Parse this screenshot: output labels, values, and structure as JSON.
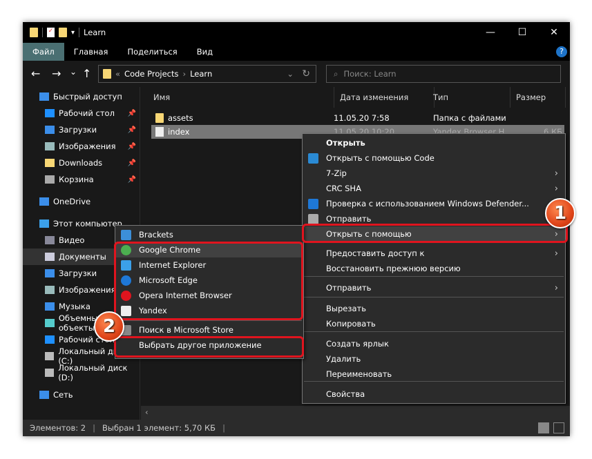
{
  "window": {
    "title": "Learn",
    "minimize": "—",
    "maximize": "☐",
    "close": "✕"
  },
  "ribbon": {
    "tabs": [
      "Файл",
      "Главная",
      "Поделиться",
      "Вид"
    ],
    "help": "?"
  },
  "nav": {
    "back": "←",
    "forward": "→",
    "recent": "⌄",
    "up": "↑",
    "breadcrumb": [
      "Code Projects",
      "Learn"
    ],
    "crumb_prefix": "«",
    "crumb_sep": "›",
    "search_placeholder": "Поиск: Learn",
    "refresh": "↻",
    "dropdown": "⌄"
  },
  "sidebar": {
    "items": [
      {
        "label": "Быстрый доступ",
        "icon": "star-icon",
        "color": "#3b8eea"
      },
      {
        "label": "Рабочий стол",
        "icon": "desktop-icon",
        "color": "#1e90ff",
        "pinned": true
      },
      {
        "label": "Загрузки",
        "icon": "download-icon",
        "color": "#3b8eea",
        "pinned": true
      },
      {
        "label": "Изображения",
        "icon": "pictures-icon",
        "color": "#9bb",
        "pinned": true
      },
      {
        "label": "Downloads",
        "icon": "folder-icon",
        "color": "#f8d775",
        "pinned": true
      },
      {
        "label": "Корзина",
        "icon": "recycle-bin-icon",
        "color": "#aaa",
        "pinned": true
      },
      {
        "label": "OneDrive",
        "icon": "cloud-icon",
        "color": "#3b8eea"
      },
      {
        "label": "Этот компьютер",
        "icon": "computer-icon",
        "color": "#3ba0ea"
      },
      {
        "label": "Видео",
        "icon": "video-icon",
        "color": "#889"
      },
      {
        "label": "Документы",
        "icon": "documents-icon",
        "color": "#ccd"
      },
      {
        "label": "Загрузки",
        "icon": "download-icon",
        "color": "#3b8eea"
      },
      {
        "label": "Изображения",
        "icon": "pictures-icon",
        "color": "#9bb"
      },
      {
        "label": "Музыка",
        "icon": "music-icon",
        "color": "#3b8eea"
      },
      {
        "label": "Объемные объекты",
        "icon": "3d-objects-icon",
        "color": "#5cc"
      },
      {
        "label": "Рабочий стол",
        "icon": "desktop-icon",
        "color": "#1e90ff"
      },
      {
        "label": "Локальный диск (C:)",
        "icon": "drive-icon",
        "color": "#bbb"
      },
      {
        "label": "Локальный диск (D:)",
        "icon": "drive-icon",
        "color": "#bbb"
      },
      {
        "label": "Сеть",
        "icon": "network-icon",
        "color": "#3b8eea"
      }
    ],
    "pin": "📌"
  },
  "columns": [
    "Имя",
    "Дата изменения",
    "Тип",
    "Размер"
  ],
  "files": [
    {
      "name": "assets",
      "date": "11.05.20 7:58",
      "type": "Папка с файлами",
      "size": ""
    },
    {
      "name": "index",
      "date": "11.05.20 10:20",
      "type": "Yandex Browser H...",
      "size": "6 КБ"
    }
  ],
  "context_menu": {
    "items": [
      {
        "label": "Открыть",
        "bold": true
      },
      {
        "label": "Открыть с помощью Code",
        "icon": "vscode-icon"
      },
      {
        "label": "7-Zip",
        "submenu": true
      },
      {
        "label": "CRC SHA",
        "submenu": true
      },
      {
        "label": "Проверка с использованием Windows Defender...",
        "icon": "defender-icon"
      },
      {
        "label": "Отправить",
        "icon": "share-icon"
      },
      {
        "label": "Открыть с помощью",
        "submenu": true,
        "highlighted": true
      },
      {
        "label": "Предоставить доступ к",
        "submenu": true
      },
      {
        "label": "Восстановить прежнюю версию"
      },
      {
        "label": "Отправить",
        "submenu": true
      },
      {
        "label": "Вырезать"
      },
      {
        "label": "Копировать"
      },
      {
        "label": "Создать ярлык"
      },
      {
        "label": "Удалить"
      },
      {
        "label": "Переименовать"
      },
      {
        "label": "Свойства"
      }
    ]
  },
  "open_with_menu": {
    "items": [
      {
        "label": "Brackets",
        "icon": "brackets-icon",
        "color": "#3c8fd8"
      },
      {
        "label": "Google Chrome",
        "icon": "chrome-icon",
        "color": "#4caf50",
        "highlighted": true
      },
      {
        "label": "Internet Explorer",
        "icon": "internet-explorer-icon",
        "color": "#3ba0ea"
      },
      {
        "label": "Microsoft Edge",
        "icon": "edge-icon",
        "color": "#1e78d7"
      },
      {
        "label": "Opera Internet Browser",
        "icon": "opera-icon",
        "color": "#e0141e"
      },
      {
        "label": "Yandex",
        "icon": "yandex-icon",
        "color": "#eeeeee"
      },
      {
        "label": "Поиск в Microsoft Store",
        "icon": "store-icon",
        "color": "#888"
      },
      {
        "label": "Выбрать другое приложение"
      }
    ]
  },
  "annotations": {
    "step1": "1",
    "step2": "2",
    "highlight_color": "#e0141e"
  },
  "status": {
    "count": "Элементов: 2",
    "selected": "Выбран 1 элемент: 5,70 КБ"
  }
}
